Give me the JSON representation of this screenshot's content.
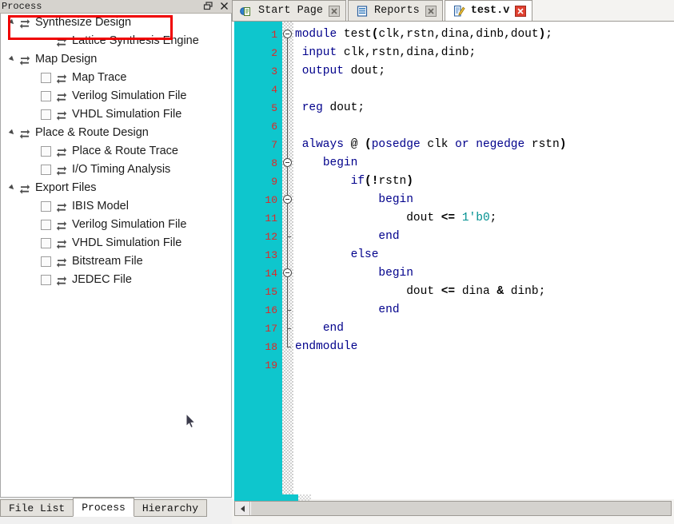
{
  "panel": {
    "title": "Process",
    "float_button": "restore-icon",
    "close_button": "close-icon"
  },
  "tree": {
    "items": [
      {
        "label": "Synthesize Design",
        "level": 0,
        "expander": "collapse-triangle",
        "checkbox": false,
        "icon": "process-refresh-icon",
        "highlighted": true
      },
      {
        "label": "Lattice Synthesis Engine",
        "level": 1,
        "expander": "none",
        "checkbox": false,
        "icon": "process-refresh-icon",
        "highlighted": false
      },
      {
        "label": "Map Design",
        "level": 0,
        "expander": "collapse-triangle",
        "checkbox": false,
        "icon": "process-refresh-icon",
        "highlighted": false
      },
      {
        "label": "Map Trace",
        "level": 1,
        "expander": "none",
        "checkbox": true,
        "icon": "process-refresh-icon",
        "highlighted": false
      },
      {
        "label": "Verilog Simulation File",
        "level": 1,
        "expander": "none",
        "checkbox": true,
        "icon": "process-refresh-icon",
        "highlighted": false
      },
      {
        "label": "VHDL Simulation File",
        "level": 1,
        "expander": "none",
        "checkbox": true,
        "icon": "process-refresh-icon",
        "highlighted": false
      },
      {
        "label": "Place & Route Design",
        "level": 0,
        "expander": "collapse-triangle",
        "checkbox": false,
        "icon": "process-refresh-icon",
        "highlighted": false
      },
      {
        "label": "Place & Route Trace",
        "level": 1,
        "expander": "none",
        "checkbox": true,
        "icon": "process-refresh-icon",
        "highlighted": false
      },
      {
        "label": "I/O Timing Analysis",
        "level": 1,
        "expander": "none",
        "checkbox": true,
        "icon": "process-refresh-icon",
        "highlighted": false
      },
      {
        "label": "Export Files",
        "level": 0,
        "expander": "collapse-triangle",
        "checkbox": false,
        "icon": "process-refresh-icon",
        "highlighted": false
      },
      {
        "label": "IBIS Model",
        "level": 1,
        "expander": "none",
        "checkbox": true,
        "icon": "process-refresh-icon",
        "highlighted": false
      },
      {
        "label": "Verilog Simulation File",
        "level": 1,
        "expander": "none",
        "checkbox": true,
        "icon": "process-refresh-icon",
        "highlighted": false
      },
      {
        "label": "VHDL Simulation File",
        "level": 1,
        "expander": "none",
        "checkbox": true,
        "icon": "process-refresh-icon",
        "highlighted": false
      },
      {
        "label": "Bitstream File",
        "level": 1,
        "expander": "none",
        "checkbox": true,
        "icon": "process-refresh-icon",
        "highlighted": false
      },
      {
        "label": "JEDEC File",
        "level": 1,
        "expander": "none",
        "checkbox": true,
        "icon": "process-refresh-icon",
        "highlighted": false
      }
    ]
  },
  "annotation": {
    "color": "#ef0000",
    "target": "Synthesize Design"
  },
  "bottom_tabs": [
    {
      "label": "File List",
      "active": false
    },
    {
      "label": "Process",
      "active": true
    },
    {
      "label": "Hierarchy",
      "active": false
    }
  ],
  "editor_tabs": [
    {
      "label": "Start Page",
      "icon": "start-page-icon",
      "close": "close-icon-grey",
      "active": false
    },
    {
      "label": "Reports",
      "icon": "reports-icon",
      "close": "close-icon-grey",
      "active": false
    },
    {
      "label": "test.v",
      "icon": "edit-file-icon",
      "close": "close-icon-red",
      "active": true
    }
  ],
  "editor": {
    "gutter_color": "#0ec6cd",
    "linenum_color": "#e02626",
    "line_numbers": [
      "1",
      "2",
      "3",
      "4",
      "5",
      "6",
      "7",
      "8",
      "9",
      "10",
      "11",
      "12",
      "13",
      "14",
      "15",
      "16",
      "17",
      "18",
      "19"
    ],
    "lines": [
      {
        "n": 1,
        "tokens": [
          {
            "t": "module",
            "c": "kw"
          },
          {
            "t": " ",
            "c": "id"
          },
          {
            "t": "test",
            "c": "id"
          },
          {
            "t": "(",
            "c": "op"
          },
          {
            "t": "clk,rstn,dina,dinb,dout",
            "c": "id"
          },
          {
            "t": ")",
            "c": "op"
          },
          {
            "t": ";",
            "c": "pun"
          }
        ]
      },
      {
        "n": 2,
        "tokens": [
          {
            "t": " ",
            "c": "id"
          },
          {
            "t": "input",
            "c": "kw"
          },
          {
            "t": " clk,rstn,dina,dinb;",
            "c": "id"
          }
        ]
      },
      {
        "n": 3,
        "tokens": [
          {
            "t": " ",
            "c": "id"
          },
          {
            "t": "output",
            "c": "kw"
          },
          {
            "t": " dout;",
            "c": "id"
          }
        ]
      },
      {
        "n": 4,
        "tokens": []
      },
      {
        "n": 5,
        "tokens": [
          {
            "t": " ",
            "c": "id"
          },
          {
            "t": "reg",
            "c": "kw"
          },
          {
            "t": " dout;",
            "c": "id"
          }
        ]
      },
      {
        "n": 6,
        "tokens": []
      },
      {
        "n": 7,
        "tokens": [
          {
            "t": " ",
            "c": "id"
          },
          {
            "t": "always",
            "c": "kw"
          },
          {
            "t": " @ ",
            "c": "id"
          },
          {
            "t": "(",
            "c": "op"
          },
          {
            "t": "posedge",
            "c": "kw"
          },
          {
            "t": " clk ",
            "c": "id"
          },
          {
            "t": "or",
            "c": "kw"
          },
          {
            "t": " ",
            "c": "id"
          },
          {
            "t": "negedge",
            "c": "kw"
          },
          {
            "t": " rstn",
            "c": "id"
          },
          {
            "t": ")",
            "c": "op"
          }
        ]
      },
      {
        "n": 8,
        "tokens": [
          {
            "t": "    ",
            "c": "id"
          },
          {
            "t": "begin",
            "c": "kw"
          }
        ]
      },
      {
        "n": 9,
        "tokens": [
          {
            "t": "        ",
            "c": "id"
          },
          {
            "t": "if",
            "c": "kw"
          },
          {
            "t": "(!",
            "c": "op"
          },
          {
            "t": "rstn",
            "c": "id"
          },
          {
            "t": ")",
            "c": "op"
          }
        ]
      },
      {
        "n": 10,
        "tokens": [
          {
            "t": "            ",
            "c": "id"
          },
          {
            "t": "begin",
            "c": "kw"
          }
        ]
      },
      {
        "n": 11,
        "tokens": [
          {
            "t": "                dout ",
            "c": "id"
          },
          {
            "t": "<=",
            "c": "op"
          },
          {
            "t": " ",
            "c": "id"
          },
          {
            "t": "1'b0",
            "c": "num"
          },
          {
            "t": ";",
            "c": "pun"
          }
        ]
      },
      {
        "n": 12,
        "tokens": [
          {
            "t": "            ",
            "c": "id"
          },
          {
            "t": "end",
            "c": "kw"
          }
        ]
      },
      {
        "n": 13,
        "tokens": [
          {
            "t": "        ",
            "c": "id"
          },
          {
            "t": "else",
            "c": "kw"
          }
        ]
      },
      {
        "n": 14,
        "tokens": [
          {
            "t": "            ",
            "c": "id"
          },
          {
            "t": "begin",
            "c": "kw"
          }
        ]
      },
      {
        "n": 15,
        "tokens": [
          {
            "t": "                dout ",
            "c": "id"
          },
          {
            "t": "<=",
            "c": "op"
          },
          {
            "t": " dina ",
            "c": "id"
          },
          {
            "t": "&",
            "c": "op"
          },
          {
            "t": " dinb;",
            "c": "id"
          }
        ]
      },
      {
        "n": 16,
        "tokens": [
          {
            "t": "            ",
            "c": "id"
          },
          {
            "t": "end",
            "c": "kw"
          }
        ]
      },
      {
        "n": 17,
        "tokens": [
          {
            "t": "    ",
            "c": "id"
          },
          {
            "t": "end",
            "c": "kw"
          }
        ]
      },
      {
        "n": 18,
        "tokens": [
          {
            "t": "endmodule",
            "c": "kw"
          }
        ]
      },
      {
        "n": 19,
        "tokens": []
      }
    ],
    "fold_markers": [
      1,
      8,
      10,
      14
    ]
  },
  "scrollbar": {
    "left_arrow": "arrow-left-icon"
  }
}
